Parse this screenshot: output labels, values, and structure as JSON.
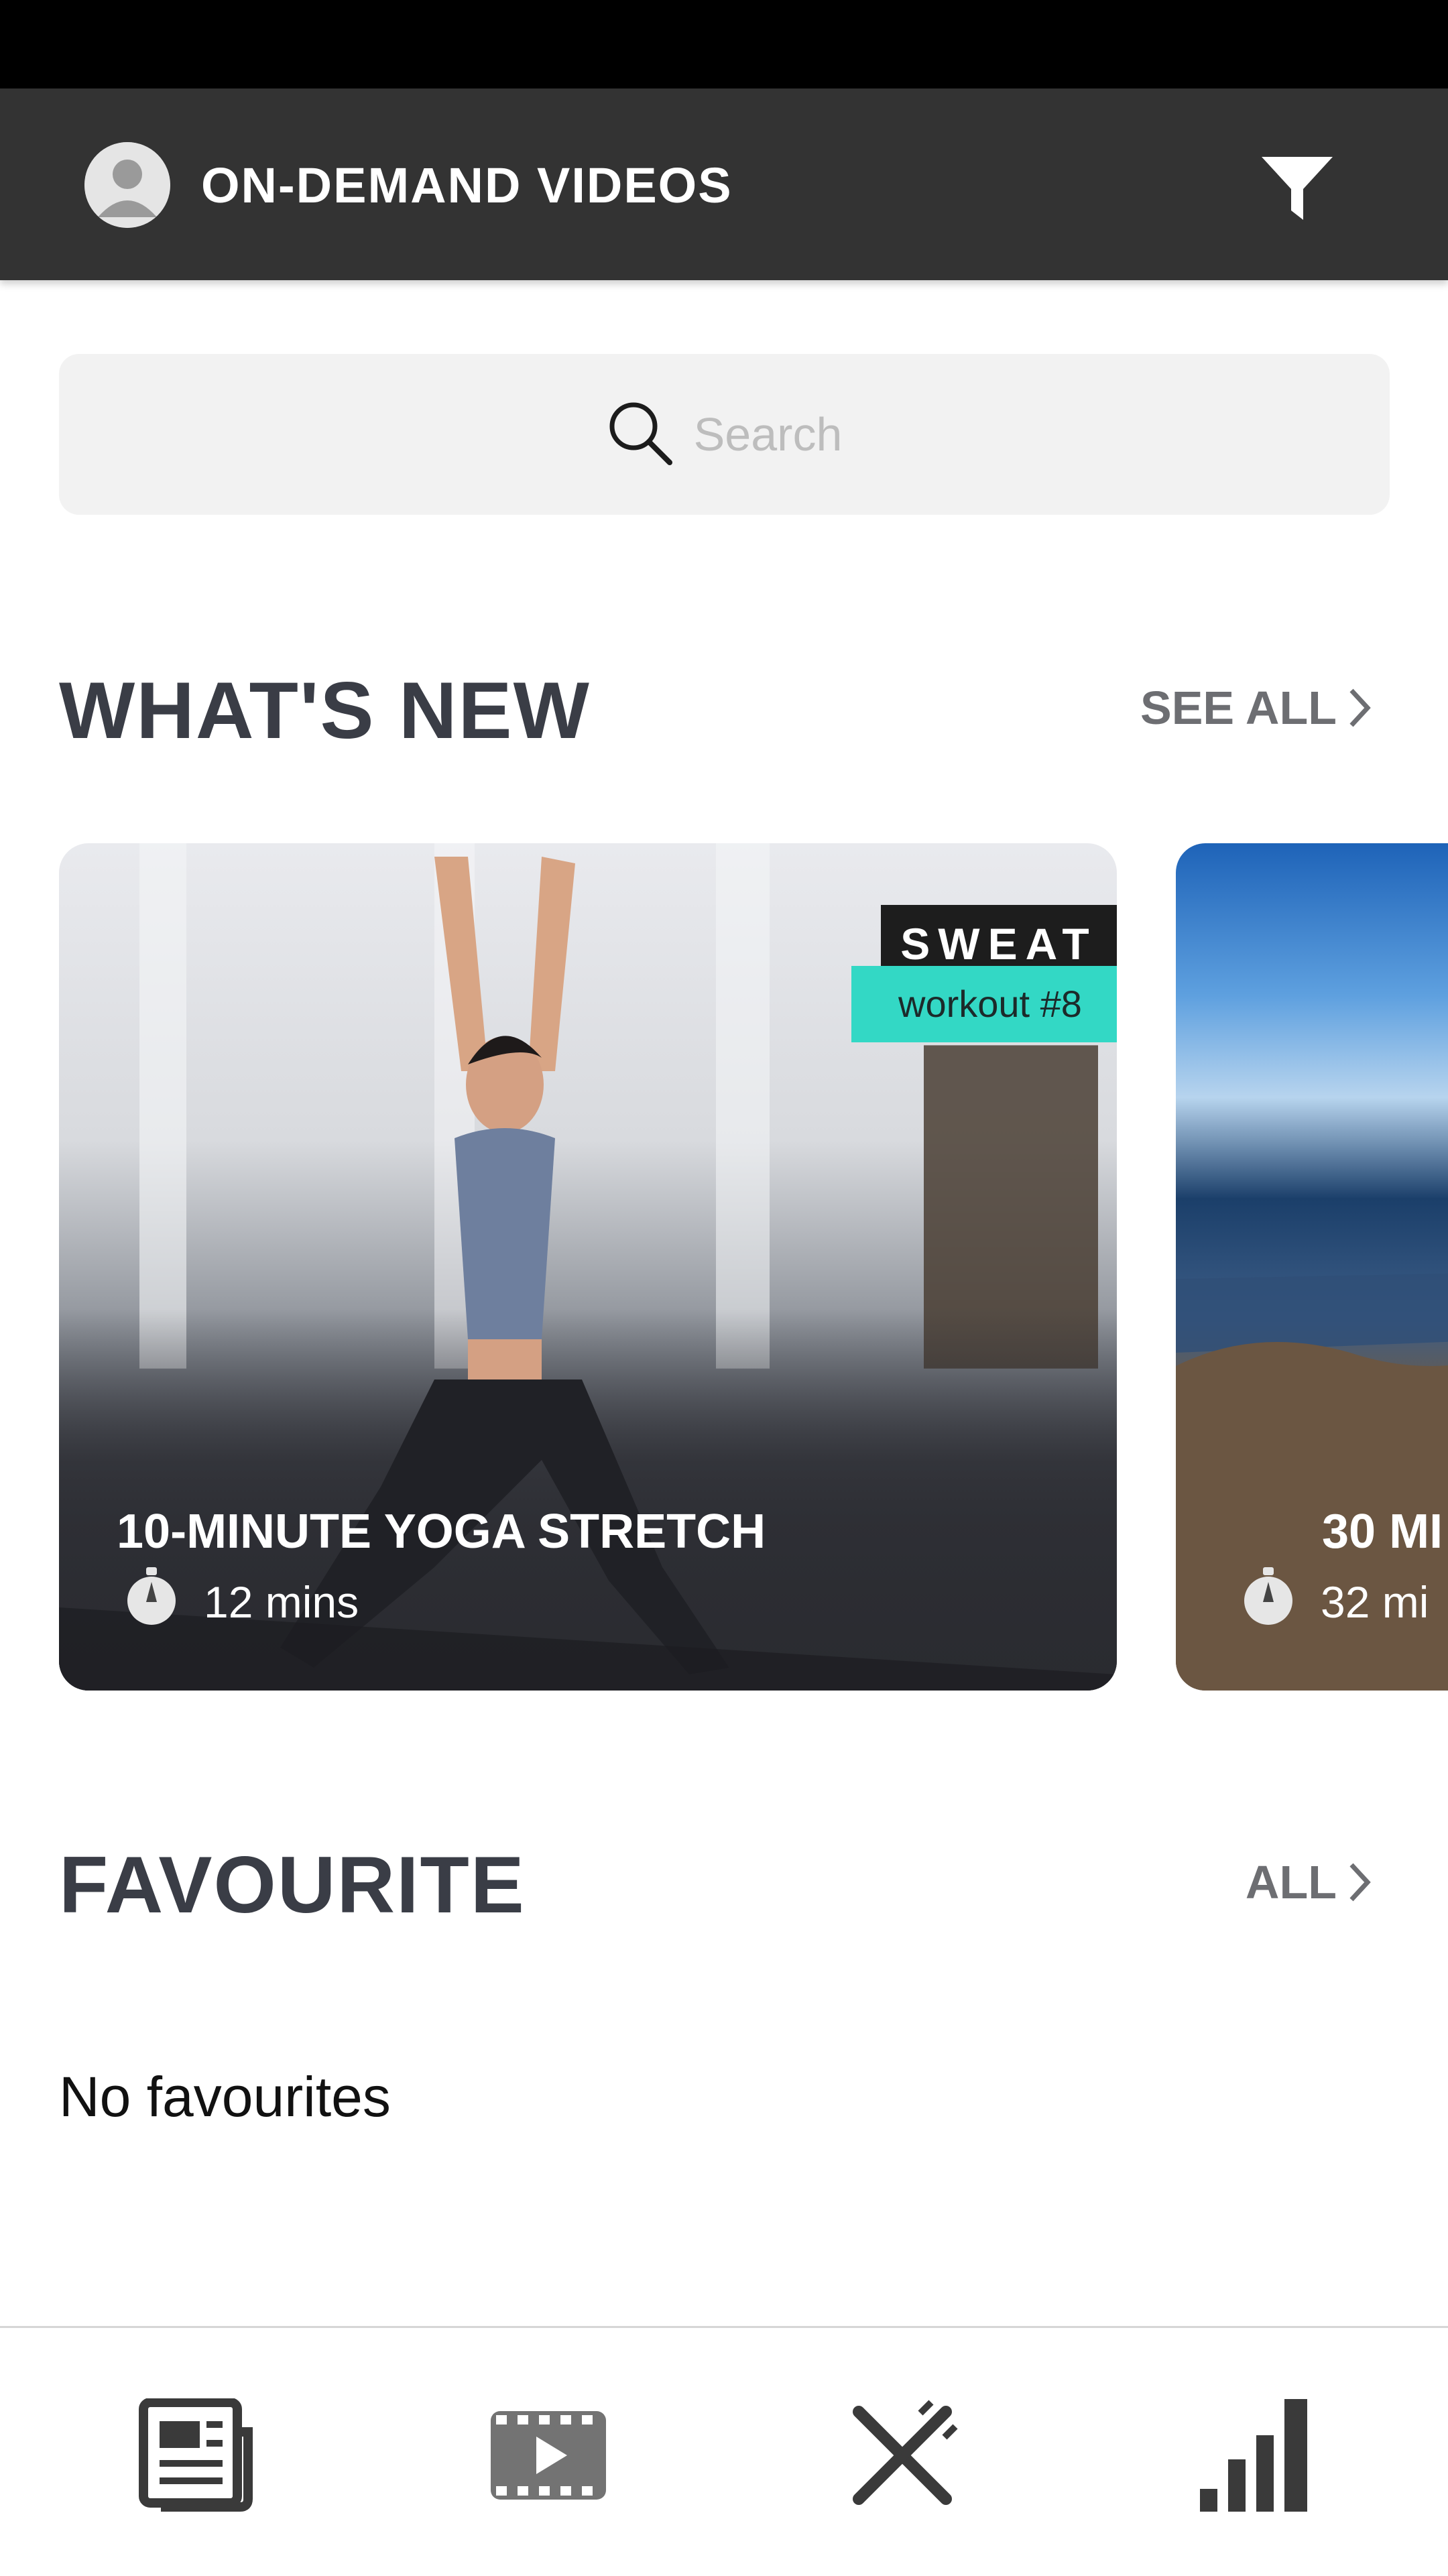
{
  "app_bar": {
    "title": "ON-DEMAND VIDEOS",
    "avatar_icon": "user-avatar-icon",
    "filter_icon": "filter-funnel-icon"
  },
  "search": {
    "placeholder": "Search",
    "icon": "search-icon"
  },
  "whats_new": {
    "title": "WHAT'S NEW",
    "see_all_label": "SEE ALL",
    "cards": [
      {
        "title": "10-MINUTE YOGA STRETCH",
        "duration": "12 mins",
        "badge_brand": "SWEAT",
        "badge_sub": "workout #8"
      },
      {
        "title": "30 MI",
        "duration": "32 mi"
      }
    ]
  },
  "favourite": {
    "title": "FAVOURITE",
    "all_label": "ALL",
    "empty_text": "No favourites"
  },
  "bottom_nav": {
    "items": [
      {
        "icon": "news-icon"
      },
      {
        "icon": "video-icon"
      },
      {
        "icon": "fork-knife-icon"
      },
      {
        "icon": "bar-chart-icon"
      }
    ]
  },
  "colors": {
    "app_bar": "#333333",
    "section_title": "#3a3d46",
    "see_all": "#6d6e72",
    "badge_accent": "#33d8c5"
  }
}
